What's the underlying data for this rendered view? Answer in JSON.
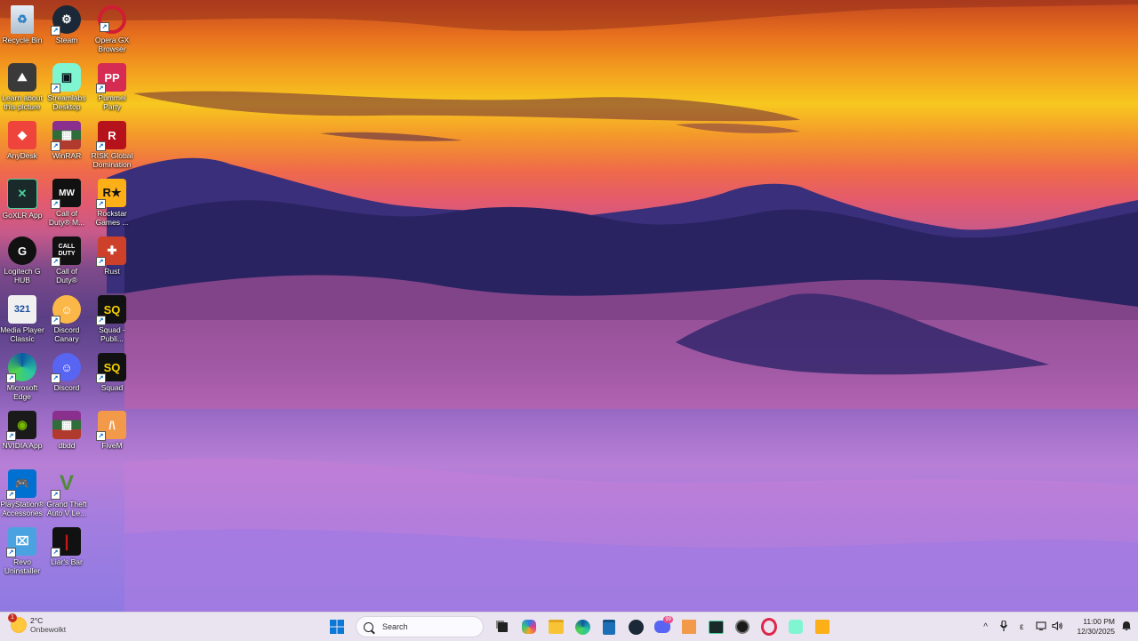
{
  "desktop": {
    "icons": [
      {
        "label": "Recycle Bin",
        "icon": "recycle-bin-icon"
      },
      {
        "label": "Steam",
        "icon": "steam-icon"
      },
      {
        "label": "Opera GX Browser",
        "icon": "opera-gx-icon"
      },
      {
        "label": "Learn about this picture",
        "icon": "learn-picture-icon"
      },
      {
        "label": "Streamlabs Desktop",
        "icon": "streamlabs-icon"
      },
      {
        "label": "Pummel Party",
        "icon": "pummel-party-icon"
      },
      {
        "label": "AnyDesk",
        "icon": "anydesk-icon"
      },
      {
        "label": "WinRAR",
        "icon": "winrar-icon"
      },
      {
        "label": "RISK Global Domination",
        "icon": "risk-icon"
      },
      {
        "label": "GoXLR App",
        "icon": "goxlr-icon"
      },
      {
        "label": "Call of Duty® M...",
        "icon": "mw3-icon"
      },
      {
        "label": "Rockstar Games ...",
        "icon": "rockstar-icon"
      },
      {
        "label": "Logitech G HUB",
        "icon": "logitech-icon"
      },
      {
        "label": "Call of Duty®",
        "icon": "call-of-duty-icon"
      },
      {
        "label": "Rust",
        "icon": "rust-icon"
      },
      {
        "label": "Media Player Classic",
        "icon": "media-player-classic-icon"
      },
      {
        "label": "Discord Canary",
        "icon": "discord-canary-icon"
      },
      {
        "label": "Squad - Publi...",
        "icon": "squad-public-icon"
      },
      {
        "label": "Microsoft Edge",
        "icon": "edge-icon"
      },
      {
        "label": "Discord",
        "icon": "discord-icon"
      },
      {
        "label": "Squad",
        "icon": "squad-icon"
      },
      {
        "label": "NVIDIA App",
        "icon": "nvidia-icon"
      },
      {
        "label": "dbdd",
        "icon": "dbdd-icon"
      },
      {
        "label": "FiveM",
        "icon": "fivem-icon"
      },
      {
        "label": "PlayStation® Accessories",
        "icon": "playstation-icon"
      },
      {
        "label": "Grand Theft Auto V Le...",
        "icon": "gta-v-icon"
      },
      {
        "label": "Revo Uninstaller",
        "icon": "revo-icon"
      },
      {
        "label": "Liar's Bar",
        "icon": "liars-bar-icon"
      }
    ]
  },
  "taskbar": {
    "weather": {
      "temp": "2°C",
      "condition": "Onbewolkt",
      "badge": "1"
    },
    "search_placeholder": "Search",
    "pinned": [
      "start-icon",
      "task-view-icon",
      "copilot-icon",
      "file-explorer-icon",
      "edge-icon",
      "store-icon",
      "steam-icon",
      "discord-icon",
      "fivem-icon",
      "goxlr-icon",
      "app-icon",
      "opera-gx-icon",
      "streamlabs-icon",
      "rockstar-icon"
    ],
    "discord_badge": "99",
    "tray": {
      "chevron": "^",
      "lang": "ε",
      "time": "11:00 PM",
      "date": "12/30/2025"
    }
  }
}
